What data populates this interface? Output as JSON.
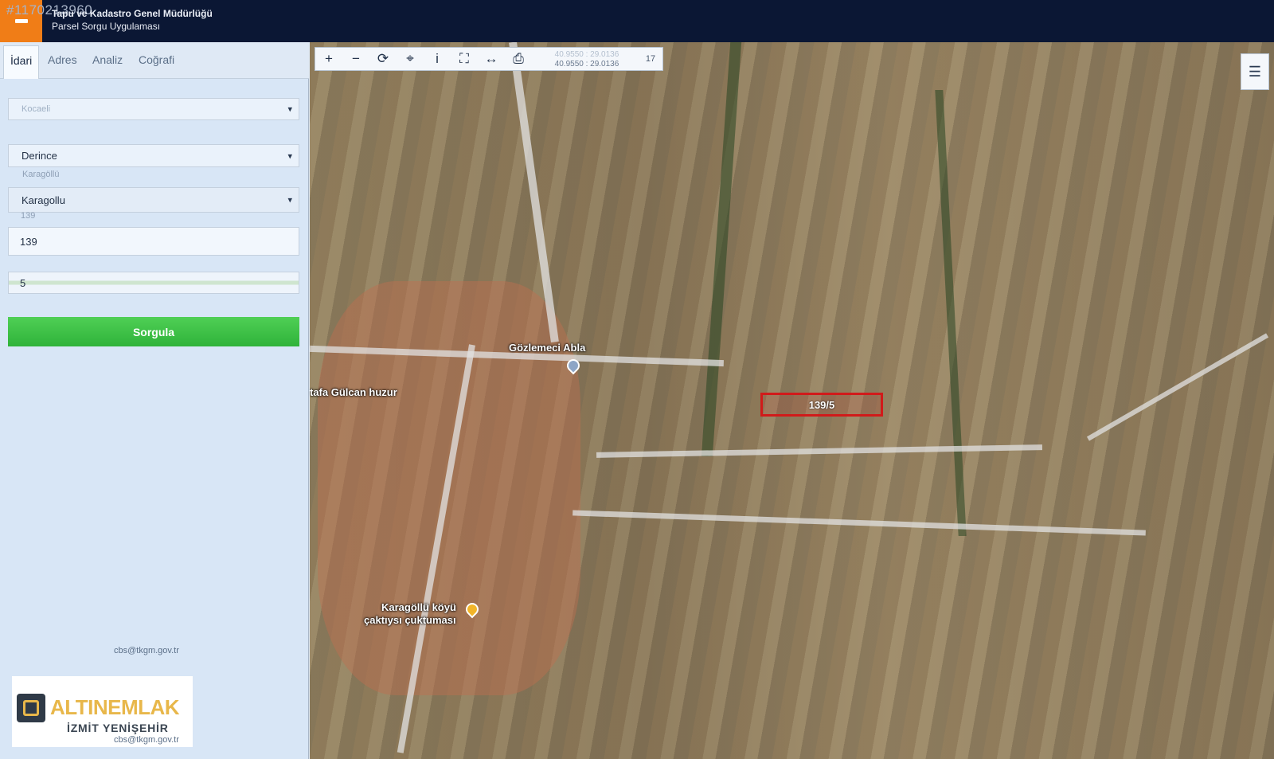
{
  "listing_id": "#1170213960",
  "header": {
    "title": "Tapu ve Kadastro Genel Müdürlüğü",
    "subtitle": "Parsel Sorgu Uygulaması"
  },
  "tabs": [
    {
      "label": "İdari",
      "active": true
    },
    {
      "label": "Adres",
      "active": false
    },
    {
      "label": "Analiz",
      "active": false
    },
    {
      "label": "Coğrafi",
      "active": false
    }
  ],
  "form": {
    "faded_top": "Kocaeli",
    "district": "Derince",
    "faded_neighborhood": "Karagöllü",
    "neighborhood": "Karagollu",
    "faded_block": "139",
    "block": "139",
    "parcel": "5",
    "query_label": "Sorgula"
  },
  "map": {
    "coords": "40.9550 : 29.0136",
    "coords_faded": "40.9550 : 29.0136",
    "zoom": "17",
    "parcel_label": "139/5",
    "labels": {
      "poi_cafe": "Gözlemeci Abla",
      "poi_person": "tafa Gülcan huzur",
      "poi_village": "Karagöllü köyü",
      "poi_village_2": "çaktıysı çuktuması"
    },
    "colors": {
      "parcel_border": "#d11a1a",
      "header_bg": "#0b1734",
      "menu_btn": "#f07d17",
      "query_btn": "#2fb33a"
    }
  },
  "footer": {
    "email": "cbs@tkgm.gov.tr"
  },
  "watermark": {
    "brand": "ALTINEMLAK",
    "location": "İZMİT YENİŞEHİR"
  }
}
